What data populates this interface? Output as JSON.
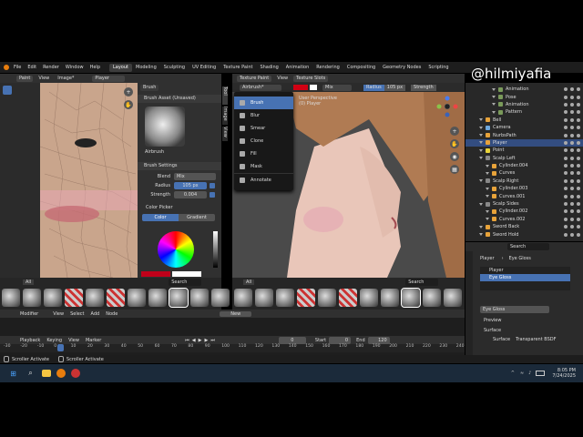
{
  "watermark": "@hilmiyafia",
  "menubar": {
    "items": [
      "File",
      "Edit",
      "Render",
      "Window",
      "Help"
    ],
    "workspaces": [
      "Layout",
      "Modeling",
      "Sculpting",
      "UV Editing",
      "Texture Paint",
      "Shading",
      "Animation",
      "Rendering",
      "Compositing",
      "Geometry Nodes",
      "Scripting"
    ],
    "active_workspace": "Layout"
  },
  "image_editor": {
    "header": {
      "mode": "Paint",
      "view": "View",
      "image": "Image*",
      "slot": "Player"
    },
    "tool_button": "Brush",
    "brush_asset_title": "Brush Asset (Unsaved)",
    "brush_name": "Airbrush",
    "brush_settings_title": "Brush Settings",
    "blend_label": "Blend",
    "blend_value": "Mix",
    "radius_label": "Radius",
    "radius_value": "105 px",
    "strength_label": "Strength",
    "strength_value": "0.004",
    "color_picker_title": "Color Picker",
    "color_tab": "Color",
    "gradient_tab": "Gradient",
    "side_tabs": [
      "Tool",
      "Image",
      "View"
    ],
    "brush_search": "Search",
    "all_label": "All"
  },
  "viewport": {
    "header": {
      "mode": "Texture Paint",
      "view": "View",
      "slots": "Texture Slots",
      "brush": "Airbrush*",
      "blend": "Mix",
      "radius_label": "Radius",
      "radius_value": "105 px",
      "strength_label": "Strength"
    },
    "overlay_line1": "User Perspective",
    "overlay_line2": "(0) Player",
    "brush_search": "Search",
    "all_label": "All",
    "tool_menu": [
      {
        "label": "Brush",
        "selected": true
      },
      {
        "label": "Blur",
        "selected": false
      },
      {
        "label": "Smear",
        "selected": false
      },
      {
        "label": "Clone",
        "selected": false
      },
      {
        "label": "Fill",
        "selected": false
      },
      {
        "label": "Mask",
        "selected": false
      },
      {
        "label": "Annotate",
        "selected": false
      }
    ]
  },
  "outliner": {
    "rows": [
      {
        "label": "Animation",
        "indent": 3,
        "color": "#7a9a5a",
        "selected": false
      },
      {
        "label": "Pose",
        "indent": 3,
        "color": "#7a9a5a",
        "selected": false
      },
      {
        "label": "Animation",
        "indent": 3,
        "color": "#7a9a5a",
        "selected": false
      },
      {
        "label": "Pattern",
        "indent": 3,
        "color": "#7a9a5a",
        "selected": false
      },
      {
        "label": "Bell",
        "indent": 1,
        "color": "#e8a33a",
        "selected": false
      },
      {
        "label": "Camera",
        "indent": 1,
        "color": "#6fa8dc",
        "selected": false
      },
      {
        "label": "NurbsPath",
        "indent": 1,
        "color": "#e8a33a",
        "selected": false
      },
      {
        "label": "Player",
        "indent": 1,
        "color": "#e8a33a",
        "selected": true
      },
      {
        "label": "Point",
        "indent": 1,
        "color": "#e8d33a",
        "selected": false
      },
      {
        "label": "Scalp Left",
        "indent": 1,
        "color": "#888",
        "selected": false
      },
      {
        "label": "Cylinder.004",
        "indent": 2,
        "color": "#e8a33a",
        "selected": false
      },
      {
        "label": "Curves",
        "indent": 2,
        "color": "#e8a33a",
        "selected": false
      },
      {
        "label": "Scalp Right",
        "indent": 1,
        "color": "#888",
        "selected": false
      },
      {
        "label": "Cylinder.003",
        "indent": 2,
        "color": "#e8a33a",
        "selected": false
      },
      {
        "label": "Curves.001",
        "indent": 2,
        "color": "#e8a33a",
        "selected": false
      },
      {
        "label": "Scalp Sides",
        "indent": 1,
        "color": "#888",
        "selected": false
      },
      {
        "label": "Cylinder.002",
        "indent": 2,
        "color": "#e8a33a",
        "selected": false
      },
      {
        "label": "Curves.002",
        "indent": 2,
        "color": "#e8a33a",
        "selected": false
      },
      {
        "label": "Sword Back",
        "indent": 1,
        "color": "#e8a33a",
        "selected": false
      },
      {
        "label": "Sword Hold",
        "indent": 1,
        "color": "#e8a33a",
        "selected": false
      }
    ]
  },
  "properties": {
    "search": "Search",
    "breadcrumb_object": "Player",
    "breadcrumb_material": "Eye Gloss",
    "slot_list": [
      {
        "label": "Player",
        "selected": false
      },
      {
        "label": "Eye Gloss",
        "selected": true
      }
    ],
    "material_field": "Eye Gloss",
    "preview_label": "Preview",
    "surface_label": "Surface",
    "surface_row_label": "Surface",
    "surface_row_value": "Transparent BSDF"
  },
  "node_editor": {
    "items": [
      "Modifier",
      "View",
      "Select",
      "Add",
      "Node"
    ],
    "new_button": "New"
  },
  "timeline": {
    "items": [
      "Playback",
      "Keying",
      "View",
      "Marker"
    ],
    "current_frame": "0",
    "start_label": "Start",
    "start_value": "0",
    "end_label": "End",
    "end_value": "120",
    "ticks": [
      "-30",
      "-20",
      "-10",
      "0",
      "10",
      "20",
      "30",
      "40",
      "50",
      "60",
      "70",
      "80",
      "90",
      "100",
      "110",
      "120",
      "130",
      "140",
      "150",
      "160",
      "170",
      "180",
      "190",
      "200",
      "210",
      "220",
      "230",
      "240"
    ],
    "version": "4.4.0"
  },
  "statusbar": {
    "left": "Scroller Activate",
    "middle": "Scroller Activate"
  },
  "taskbar": {
    "search_placeholder": "Search",
    "time": "8:05 PM",
    "date": "7/24/2025"
  }
}
